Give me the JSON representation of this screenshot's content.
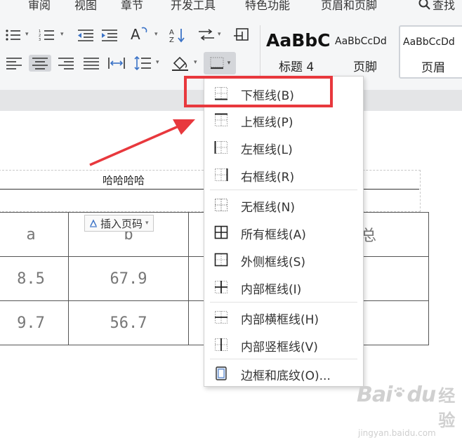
{
  "menu": {
    "items": [
      "审阅",
      "视图",
      "章节",
      "开发工具",
      "特色功能",
      "页眉和页脚",
      "查找"
    ]
  },
  "styles": [
    {
      "sample": "AaBbC",
      "name": "标题 4"
    },
    {
      "sample": "AaBbCcDd",
      "name": "页脚"
    },
    {
      "sample": "AaBbCcDd",
      "name": "页眉"
    }
  ],
  "document": {
    "header_text": "哈哈哈哈",
    "insert_page_number": "插入页码",
    "table": {
      "rows": [
        [
          "a",
          "b",
          "",
          "总"
        ],
        [
          "8.5",
          "67.9",
          "",
          ""
        ],
        [
          "9.7",
          "56.7",
          "",
          ""
        ]
      ]
    }
  },
  "dropdown": {
    "items": [
      {
        "label": "下框线(B)",
        "icon": "border-bottom-icon"
      },
      {
        "label": "上框线(P)",
        "icon": "border-top-icon"
      },
      {
        "label": "左框线(L)",
        "icon": "border-left-icon"
      },
      {
        "label": "右框线(R)",
        "icon": "border-right-icon"
      },
      {
        "label": "无框线(N)",
        "icon": "border-none-icon"
      },
      {
        "label": "所有框线(A)",
        "icon": "border-all-icon"
      },
      {
        "label": "外侧框线(S)",
        "icon": "border-outside-icon"
      },
      {
        "label": "内部框线(I)",
        "icon": "border-inside-icon"
      },
      {
        "label": "内部横框线(H)",
        "icon": "border-inside-horizontal-icon"
      },
      {
        "label": "内部竖框线(V)",
        "icon": "border-inside-vertical-icon"
      },
      {
        "label": "边框和底纹(O)...",
        "icon": "borders-and-shading-icon"
      }
    ]
  },
  "watermark": {
    "brand": "Bai",
    "brand2": "du",
    "suffix": "经验",
    "url": "jingyan.baidu.com"
  },
  "colors": {
    "accent_red": "#e8383d",
    "ribbon_bg": "#f5f6f7",
    "active_btn": "#d4d6da"
  }
}
